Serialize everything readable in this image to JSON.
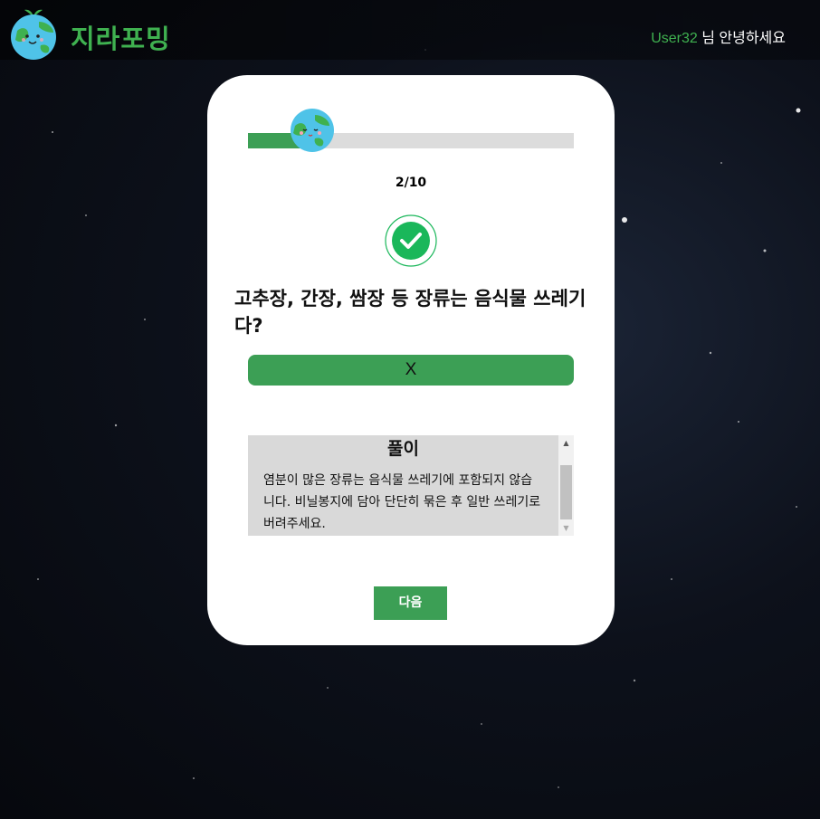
{
  "header": {
    "logo_text": "지라포밍",
    "greeting_user": "User32",
    "greeting_suffix": " 님 안녕하세요"
  },
  "quiz": {
    "progress_fraction": 0.2,
    "current": "2",
    "separator": "/",
    "total": "10",
    "question": "고추장, 간장, 쌈장 등 장류는 음식물 쓰레기다?",
    "answer": "X",
    "explanation_title": "풀이",
    "explanation_text": "염분이 많은 장류는 음식물 쓰레기에 포함되지 않습니다. 비닐봉지에 담아 단단히 묶은 후 일반 쓰레기로 버려주세요.",
    "next_label": "다음"
  },
  "colors": {
    "accent": "#3c9f55",
    "logo_green": "#3fb150",
    "check": "#1ab75a"
  }
}
